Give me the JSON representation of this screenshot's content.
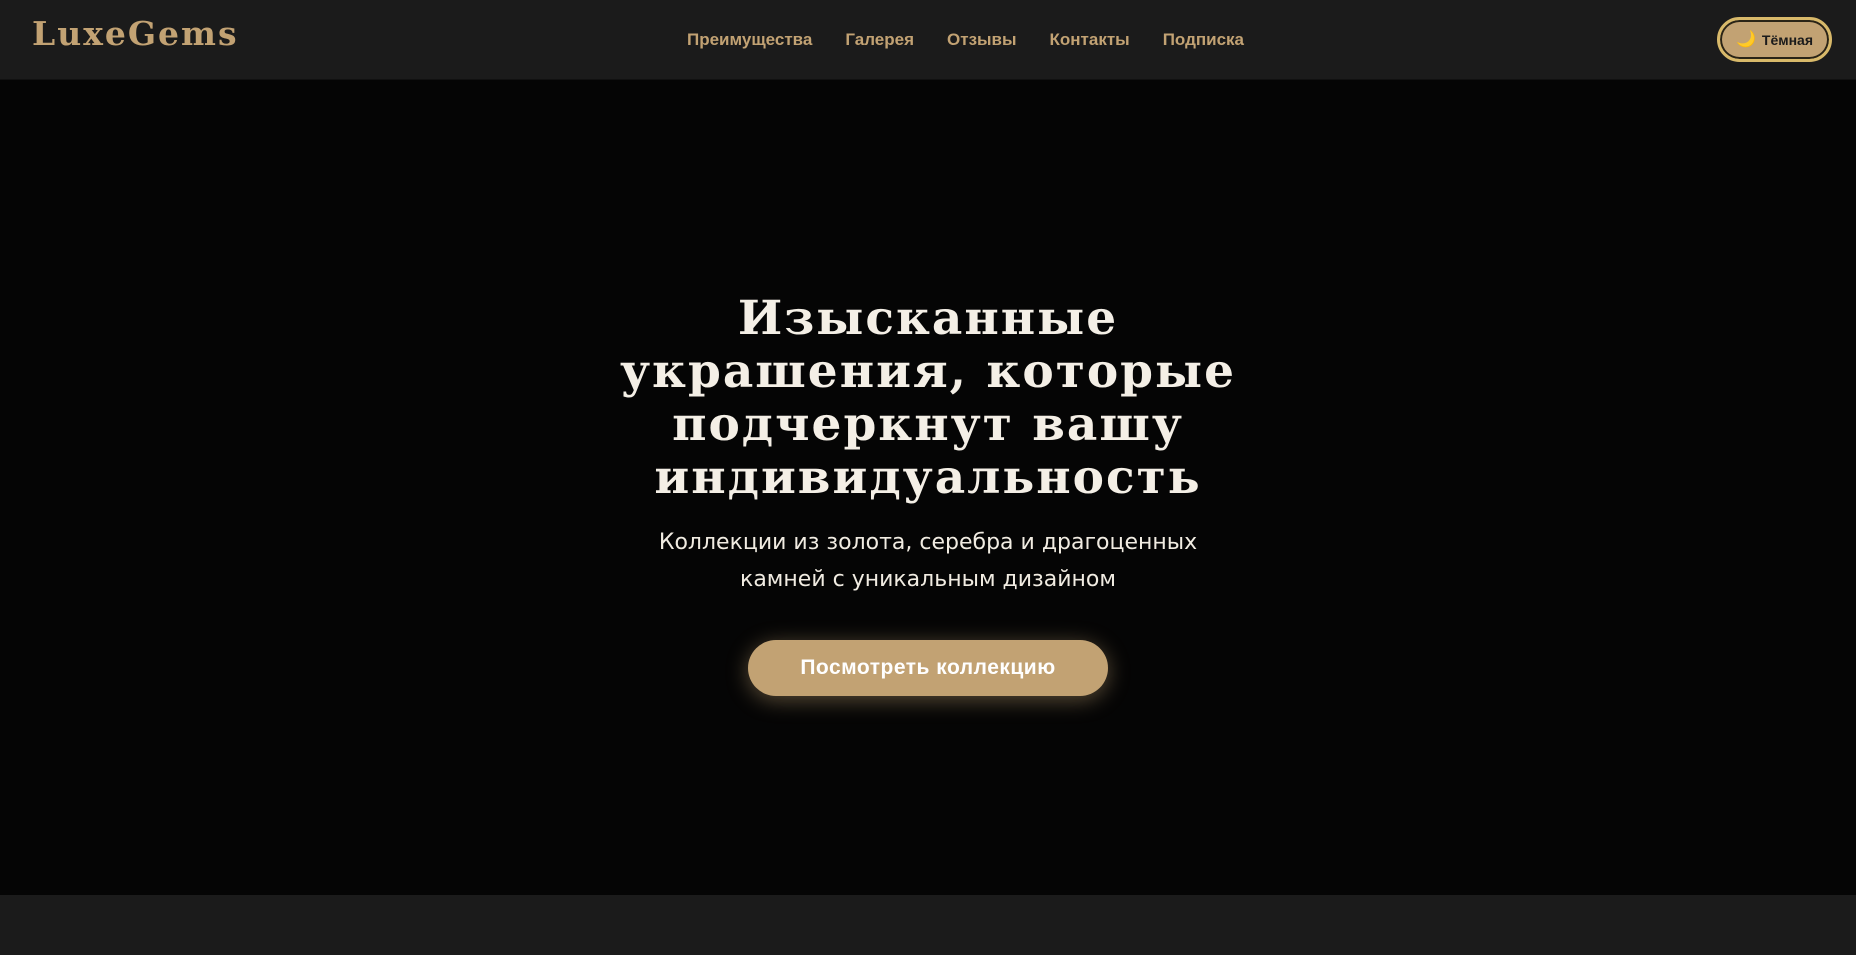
{
  "header": {
    "logo": "LuxeGems",
    "nav": [
      {
        "label": "Преимущества"
      },
      {
        "label": "Галерея"
      },
      {
        "label": "Отзывы"
      },
      {
        "label": "Контакты"
      },
      {
        "label": "Подписка"
      }
    ],
    "theme_toggle": {
      "icon": "moon-icon",
      "glyph": "🌙",
      "label": "Тёмная"
    }
  },
  "hero": {
    "title": "Изысканные украшения, которые подчеркнут вашу индивидуальность",
    "subtitle": "Коллекции из золота, серебра и драгоценных камней с уникальным дизайном",
    "cta_label": "Посмотреть коллекцию"
  },
  "colors": {
    "accent": "#c2a273",
    "header_bg": "#1b1b1b",
    "hero_bg": "#050505",
    "hero_text": "#f4efe6"
  }
}
